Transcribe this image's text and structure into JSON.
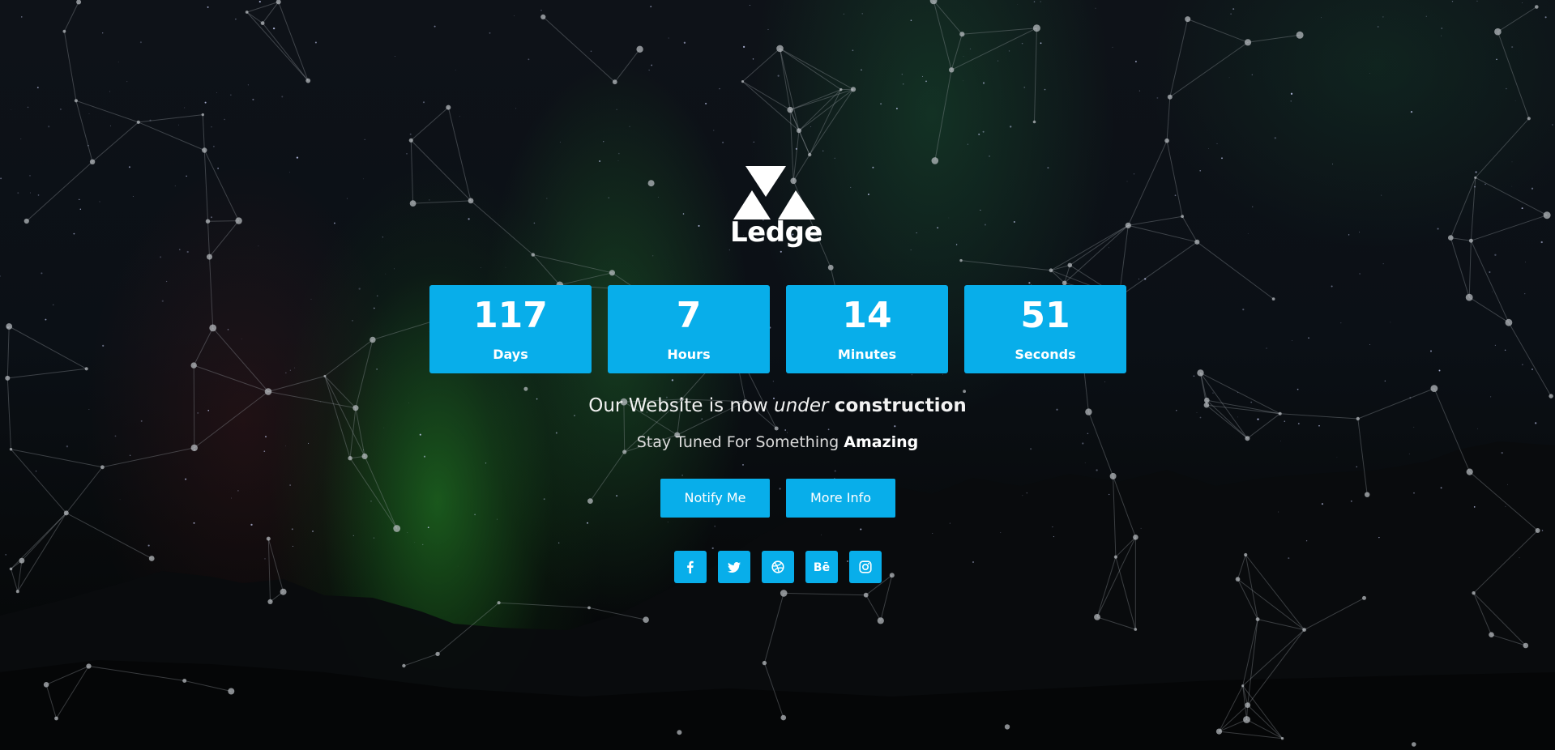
{
  "brand": {
    "name": "Ledge"
  },
  "countdown": [
    {
      "value": "117",
      "label": "Days"
    },
    {
      "value": "7",
      "label": "Hours"
    },
    {
      "value": "14",
      "label": "Minutes"
    },
    {
      "value": "51",
      "label": "Seconds"
    }
  ],
  "headline": {
    "part1": "Our Website is now ",
    "emphasis": "under",
    "part2": " ",
    "strong": "construction"
  },
  "tagline": {
    "text": "Stay Tuned For Something ",
    "strong": "Amazing"
  },
  "buttons": {
    "notify": "Notify Me",
    "more_info": "More Info"
  },
  "social": [
    {
      "icon": "facebook-icon"
    },
    {
      "icon": "twitter-icon"
    },
    {
      "icon": "dribbble-icon"
    },
    {
      "icon": "behance-icon",
      "glyph": "Bē"
    },
    {
      "icon": "instagram-icon"
    }
  ],
  "colors": {
    "accent": "#08aeea",
    "text": "#ffffff",
    "background": "#0b1016"
  }
}
